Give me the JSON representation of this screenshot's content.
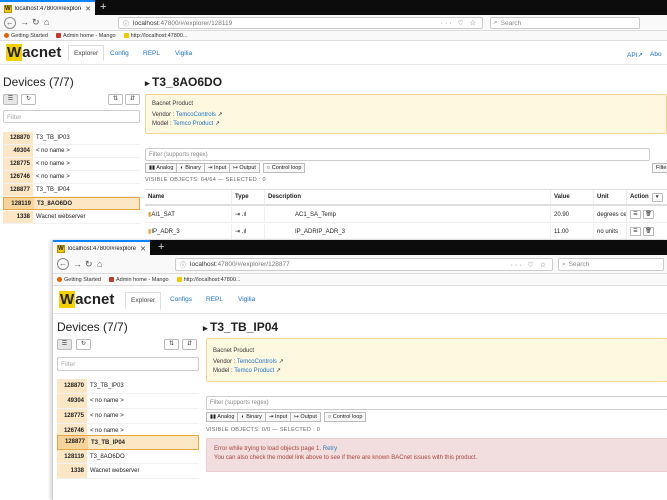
{
  "colors": {
    "brand": "#f5d000",
    "link": "#1a73c9",
    "accent": "#0a84ff",
    "selected_row": "#fce7c4",
    "error_bg": "#f2dede"
  },
  "w1": {
    "tab_title": "localhost:47800/#/explorer/128",
    "url_host": "localhost",
    "url_path": ":47800/#/explorer/128119",
    "search_placeholder": "Search",
    "bookmarks": [
      "Getting Started",
      "Admin home - Mango",
      "http://localhost:47800..."
    ],
    "logo_rest": "acnet",
    "logo_w": "W",
    "nav": [
      "Explorer",
      "Config",
      "REPL",
      "Vigilia"
    ],
    "nav_right": [
      "API",
      "Abo"
    ],
    "devices_title": "Devices (7/7)",
    "filter_placeholder": "Filter",
    "devices": [
      {
        "id": "128870",
        "name": "T3_TB_IP03"
      },
      {
        "id": "49304",
        "name": "< no name >"
      },
      {
        "id": "128775",
        "name": "< no name >"
      },
      {
        "id": "126746",
        "name": "< no name >"
      },
      {
        "id": "128877",
        "name": "T3_TB_IP04"
      },
      {
        "id": "128119",
        "name": "T3_8AO6DO"
      },
      {
        "id": "1338",
        "name": "Wacnet webserver"
      }
    ],
    "title": "T3_8AO6DO",
    "product_header": "Bacnet Product",
    "vendor_label": "Vendor : ",
    "vendor_value": "TemcoControls",
    "model_label": "Model : ",
    "model_value": "Temco Product",
    "objects_filter_placeholder": "Filter (supports regex)",
    "filter_chips": [
      "Analog",
      "Binary",
      "Input",
      "Output",
      "Control loop"
    ],
    "filter_btn": "Filte",
    "visible_objects": "VISIBLE OBJECTS: 64/64 — SELECTED : 0",
    "columns": [
      "Name",
      "Type",
      "Description",
      "Value",
      "Unit",
      "Action"
    ],
    "rows": [
      {
        "name": "AI1_SAT",
        "description": "AC1_SA_Temp",
        "value": "20.90",
        "unit": "degrees ce"
      },
      {
        "name": "IP_ADR_3",
        "description": "IP_ADRIP_ADR_3",
        "value": "11.00",
        "unit": "no units"
      }
    ]
  },
  "w2": {
    "tab_title": "localhost:47800/#/explorer/12",
    "url_host": "localhost",
    "url_path": ":47800/#/explorer/128877",
    "search_placeholder": "Search",
    "bookmarks": [
      "Getting Started",
      "Admin home - Mango",
      "http://localhost:47800..."
    ],
    "logo_rest": "acnet",
    "logo_w": "W",
    "nav": [
      "Explorer",
      "Configs",
      "REPL",
      "Vigilia"
    ],
    "devices_title": "Devices (7/7)",
    "filter_placeholder": "Filter",
    "devices": [
      {
        "id": "128870",
        "name": "T3_TB_IP03"
      },
      {
        "id": "49304",
        "name": "< no name >"
      },
      {
        "id": "128775",
        "name": "< no name >"
      },
      {
        "id": "126746",
        "name": "< no name >"
      },
      {
        "id": "128877",
        "name": "T3_TB_IP04"
      },
      {
        "id": "128119",
        "name": "T3_8AO6DO"
      },
      {
        "id": "1338",
        "name": "Wacnet webserver"
      }
    ],
    "title": "T3_TB_IP04",
    "product_header": "Bacnet Product",
    "vendor_label": "Vendor : ",
    "vendor_value": "TemcoControls",
    "model_label": "Model : ",
    "model_value": "Temco Product",
    "objects_filter_placeholder": "Filter (supports regex)",
    "filter_chips": [
      "Analog",
      "Binary",
      "Input",
      "Output",
      "Control loop"
    ],
    "visible_objects": "VISIBLE OBJECTS: 0/0 — SELECTED : 0",
    "error_line1": "Error while trying to load objects page 1.",
    "error_retry": "Retry",
    "error_line2": "You can also check the model link above to see if there are known BACnet issues with this product."
  }
}
